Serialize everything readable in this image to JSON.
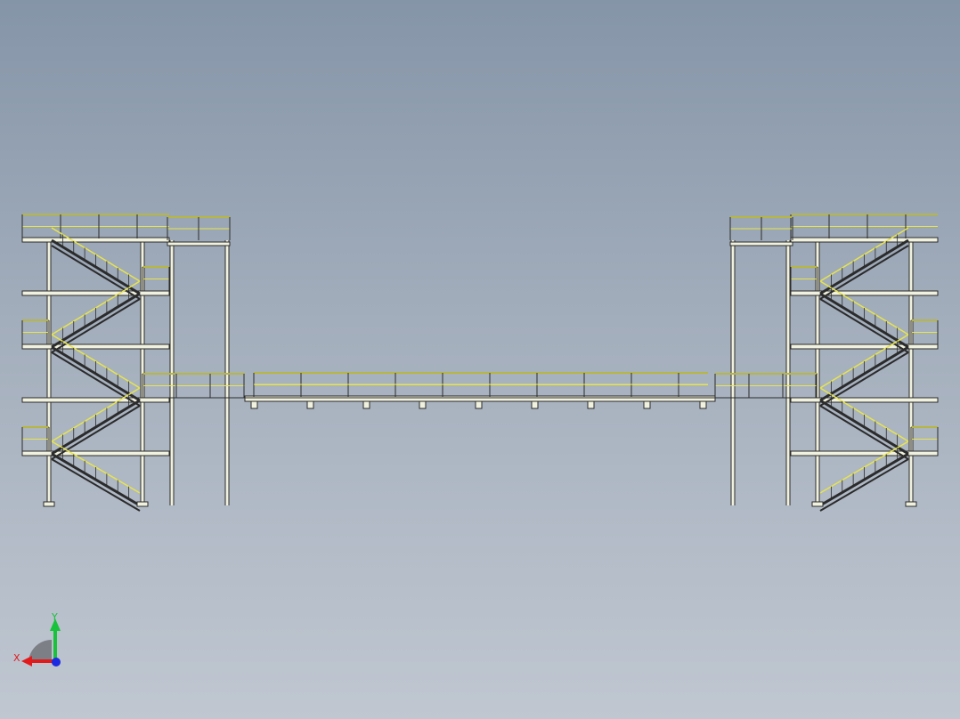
{
  "viewport": {
    "background_top": "#8595a8",
    "background_bottom": "#c0c7d1",
    "line_color": "#2b2b2b",
    "rail_color": "#e8e44a",
    "steel_color": "#f1f1df"
  },
  "triad": {
    "x_label": "X",
    "y_label": "Y",
    "x_color": "#e11b1b",
    "y_color": "#18c23a",
    "z_color": "#1b2be1"
  }
}
